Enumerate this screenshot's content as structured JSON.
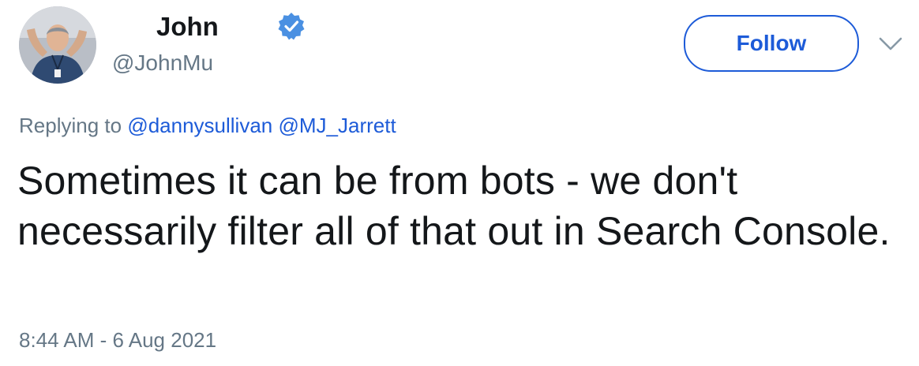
{
  "author": {
    "display_name": "John",
    "handle": "@JohnMu",
    "verified": true
  },
  "actions": {
    "follow_label": "Follow",
    "menu_icon": "chevron-down-icon"
  },
  "reply": {
    "prefix": "Replying to",
    "mentions": [
      "@dannysullivan",
      "@MJ_Jarrett"
    ]
  },
  "tweet": {
    "text": "Sometimes it can be from bots - we don't necessarily filter all of that out in Search Console.",
    "timestamp": "8:44 AM - 6 Aug 2021"
  },
  "colors": {
    "link": "#1d5bd8",
    "secondary_text": "#657786",
    "primary_text": "#14171a",
    "verified": "#4a90e2"
  }
}
